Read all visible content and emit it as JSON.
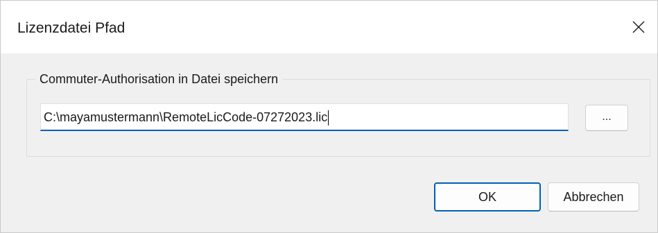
{
  "dialog": {
    "title": "Lizenzdatei Pfad",
    "close_icon": "close-icon"
  },
  "group": {
    "legend": "Commuter-Authorisation in Datei speichern",
    "path_value": "C:\\mayamustermann\\RemoteLicCode-07272023.lic",
    "browse_label": "..."
  },
  "buttons": {
    "ok_label": "OK",
    "cancel_label": "Abbrechen"
  },
  "colors": {
    "accent": "#005fb8",
    "dialog_background": "#f0f0f0",
    "titlebar_background": "#ffffff"
  }
}
